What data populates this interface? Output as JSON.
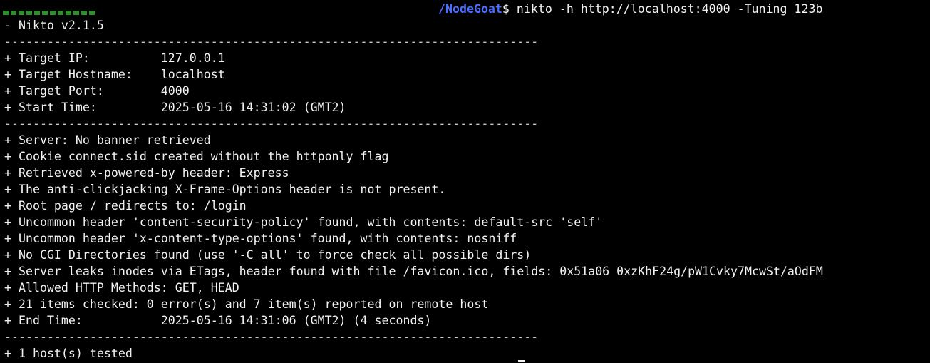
{
  "prompt": {
    "path": "/NodeGoat",
    "symbol": "$",
    "command": " nikto -h http://localhost:4000 -Tuning 123b"
  },
  "output": {
    "version": "- Nikto v2.1.5",
    "separator": "---------------------------------------------------------------------------",
    "target_ip": "+ Target IP:          127.0.0.1",
    "target_hostname": "+ Target Hostname:    localhost",
    "target_port": "+ Target Port:        4000",
    "start_time": "+ Start Time:         2025-05-16 14:31:02 (GMT2)",
    "findings": [
      "+ Server: No banner retrieved",
      "+ Cookie connect.sid created without the httponly flag",
      "+ Retrieved x-powered-by header: Express",
      "+ The anti-clickjacking X-Frame-Options header is not present.",
      "+ Root page / redirects to: /login",
      "+ Uncommon header 'content-security-policy' found, with contents: default-src 'self'",
      "+ Uncommon header 'x-content-type-options' found, with contents: nosniff",
      "+ No CGI Directories found (use '-C all' to force check all possible dirs)",
      "+ Server leaks inodes via ETags, header found with file /favicon.ico, fields: 0x51a06 0xzKhF24g/pW1Cvky7McwSt/aOdFM",
      "+ Allowed HTTP Methods: GET, HEAD",
      "+ 21 items checked: 0 error(s) and 7 item(s) reported on remote host",
      "+ End Time:           2025-05-16 14:31:06 (GMT2) (4 seconds)"
    ],
    "hosts_tested": "+ 1 host(s) tested"
  },
  "colors": {
    "background": "#000000",
    "text": "#f2f2f2",
    "prompt_path": "#4a6cff"
  }
}
